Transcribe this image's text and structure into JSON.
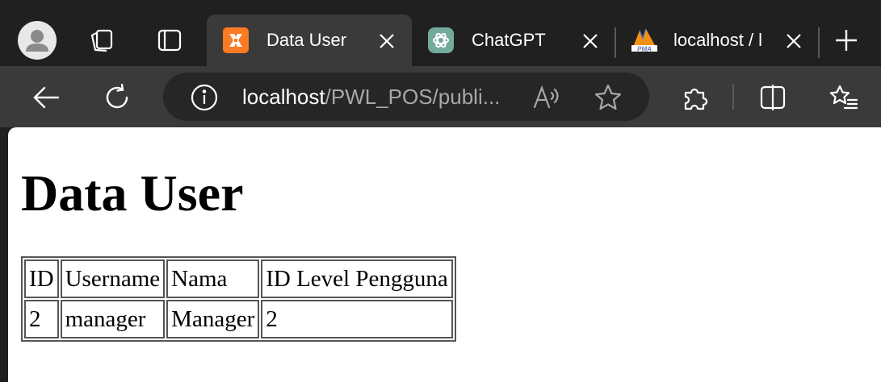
{
  "browser": {
    "tabs": [
      {
        "title": "Data User",
        "favicon": "xampp-icon",
        "active": true
      },
      {
        "title": "ChatGPT",
        "favicon": "chatgpt-icon",
        "active": false
      },
      {
        "title": "localhost / l",
        "favicon": "phpmyadmin-icon",
        "active": false
      }
    ],
    "address": {
      "host": "localhost",
      "path": "/PWL_POS/publi..."
    },
    "colors": {
      "tabstrip": "#202020",
      "toolbar": "#3a3a3a",
      "addressbar": "#262626",
      "xampp": "#fb7a24",
      "chatgpt": "#74aa9c"
    }
  },
  "page": {
    "title": "Data User",
    "table": {
      "headers": [
        "ID",
        "Username",
        "Nama",
        "ID Level Pengguna"
      ],
      "rows": [
        [
          "2",
          "manager",
          "Manager",
          "2"
        ]
      ]
    }
  }
}
